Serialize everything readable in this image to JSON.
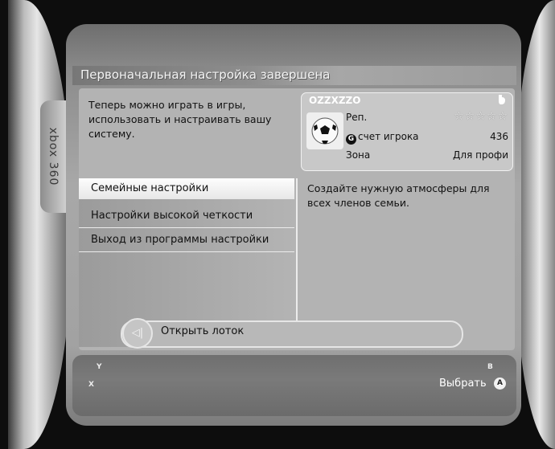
{
  "side_tab": "xbox 360",
  "title": "Первоначальная настройка завершена",
  "description": "Теперь можно играть в игры, использовать и настраивать вашу систему.",
  "gamer_card": {
    "gamertag": "OZZXZZO",
    "rep_label": "Реп.",
    "rep_stars": "☆☆☆☆☆",
    "score_label": "счет игрока",
    "score_badge": "G",
    "score_value": "436",
    "zone_label": "Зона",
    "zone_value": "Для профи"
  },
  "menu": [
    {
      "label": "Семейные настройки",
      "selected": true
    },
    {
      "label": "Настройки высокой четкости",
      "selected": false
    },
    {
      "label": "Выход из программы настройки",
      "selected": false
    }
  ],
  "selected_description": "Создайте нужную атмосферы для всех членов семьи.",
  "tray_label": "Открыть лоток",
  "buttons": {
    "y": "Y",
    "x": "X",
    "b": "B",
    "a": "A",
    "select_label": "Выбрать"
  },
  "colors": {
    "panel": "#a6a6a6",
    "highlight": "#f5f5f5"
  }
}
